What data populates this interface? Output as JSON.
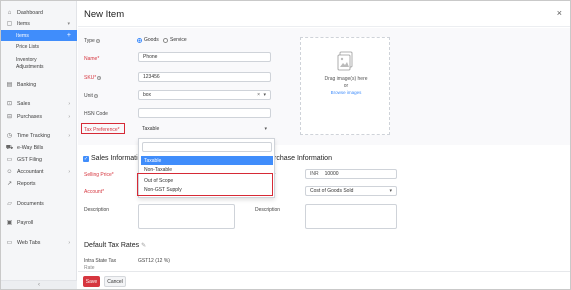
{
  "sidebar": {
    "items": [
      {
        "label": "Dashboard",
        "icon": "dashboard-icon"
      },
      {
        "label": "Items",
        "icon": "cube-icon"
      },
      {
        "label": "Items",
        "icon": "none"
      },
      {
        "label": "Banking",
        "icon": "bank-icon"
      },
      {
        "label": "Sales",
        "icon": "cart-icon"
      },
      {
        "label": "Purchases",
        "icon": "bag-icon"
      },
      {
        "label": "Time Tracking",
        "icon": "clock-icon"
      },
      {
        "label": "e-Way Bills",
        "icon": "truck-icon"
      },
      {
        "label": "GST Filing",
        "icon": "document-icon"
      },
      {
        "label": "Accountant",
        "icon": "person-icon"
      },
      {
        "label": "Reports",
        "icon": "chart-icon"
      },
      {
        "label": "Documents",
        "icon": "folder-icon"
      },
      {
        "label": "Payroll",
        "icon": "payroll-icon"
      },
      {
        "label": "Web Tabs",
        "icon": "tabs-icon"
      }
    ],
    "sub_items": [
      "Price Lists",
      "Inventory",
      "Adjustments"
    ]
  },
  "header": {
    "title": "New Item",
    "close": "×"
  },
  "form": {
    "type_label": "Type",
    "type_goods": "Goods",
    "type_service": "Service",
    "name_label": "Name*",
    "name_value": "Phone",
    "sku_label": "SKU*",
    "sku_value": "123456",
    "unit_label": "Unit",
    "unit_value": "box",
    "hsn_label": "HSN Code",
    "tax_pref_label": "Tax Preference*",
    "tax_pref_value": "Taxable"
  },
  "dropzone": {
    "line1": "Drag image(s) here",
    "line2": "or",
    "link": "Browse images"
  },
  "dropdown": {
    "options": [
      "Taxable",
      "Non-Taxable",
      "Out of Scope",
      "Non-GST Supply"
    ]
  },
  "sales": {
    "title": "Sales Information",
    "selling_price_label": "Selling Price*",
    "account_label": "Account*",
    "description_label": "Description"
  },
  "purchase": {
    "title": "rchase Information",
    "cost_currency": "INR",
    "cost_value": "10000",
    "account_value": "Cost of Goods Sold",
    "description_label": "Description"
  },
  "tax": {
    "title": "Default Tax Rates",
    "intra_label": "Intra State Tax",
    "intra_label_cont": "Rate",
    "intra_value": "GST12 (12 %)"
  },
  "footer": {
    "save": "Save",
    "cancel": "Cancel"
  },
  "colors": {
    "accent": "#408dfb",
    "danger": "#d6363f",
    "highlight": "#d62a36"
  }
}
